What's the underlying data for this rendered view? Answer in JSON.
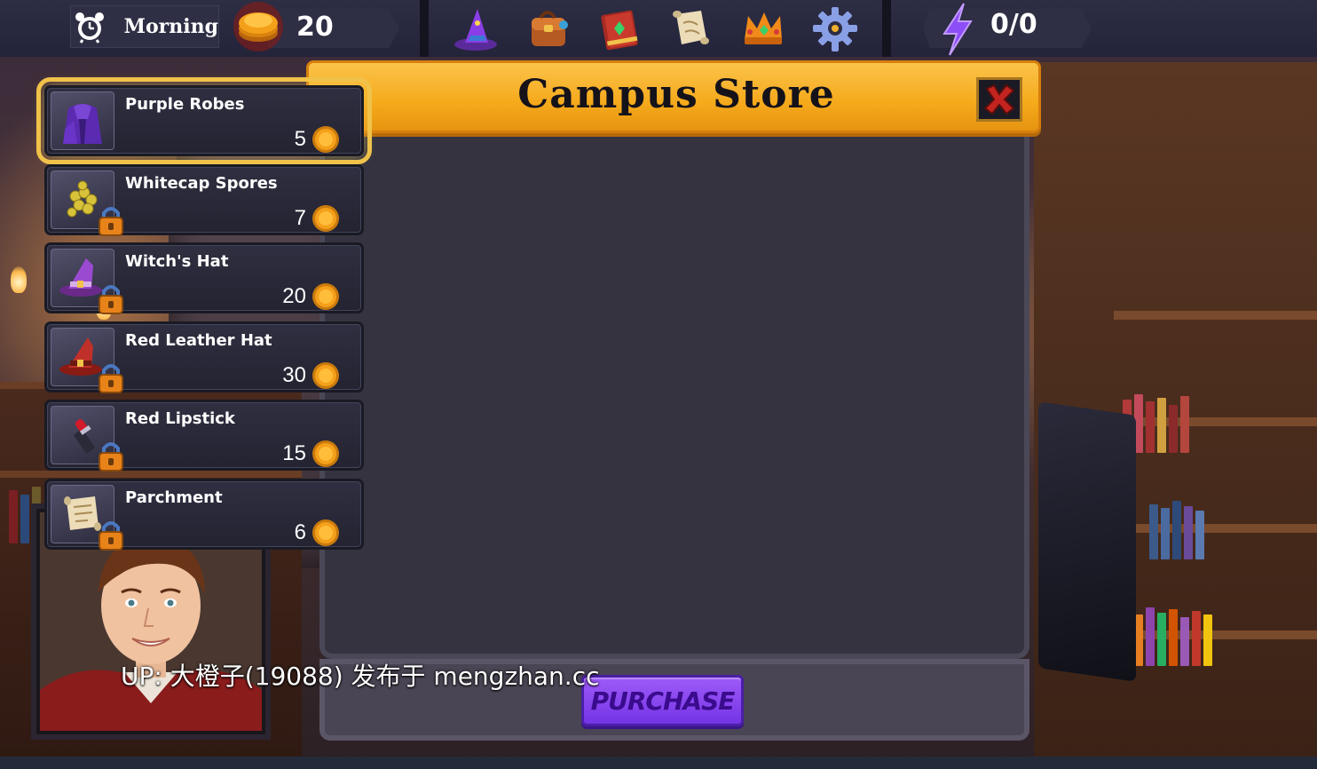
{
  "hud": {
    "time_of_day": "Morning",
    "coins": "20",
    "energy": "0/0",
    "toolbar_icons": [
      "wizard-hat-icon",
      "backpack-icon",
      "spellbook-icon",
      "scroll-map-icon",
      "crown-icon",
      "settings-gear-icon"
    ]
  },
  "store": {
    "title": "Campus Store",
    "items": [
      {
        "name": "Purple Robes",
        "price": "5",
        "locked": false,
        "selected": true,
        "icon": "purple-robes-icon"
      },
      {
        "name": "Whitecap Spores",
        "price": "7",
        "locked": true,
        "selected": false,
        "icon": "spores-icon"
      },
      {
        "name": "Witch's Hat",
        "price": "20",
        "locked": true,
        "selected": false,
        "icon": "witch-hat-icon"
      },
      {
        "name": "Red Leather Hat",
        "price": "30",
        "locked": true,
        "selected": false,
        "icon": "red-hat-icon"
      },
      {
        "name": "Red Lipstick",
        "price": "15",
        "locked": true,
        "selected": false,
        "icon": "lipstick-icon"
      },
      {
        "name": "Parchment",
        "price": "6",
        "locked": true,
        "selected": false,
        "icon": "parchment-icon"
      }
    ],
    "purchase_label": "PURCHASE"
  },
  "watermark": "UP: 大橙子(19088) 发布于 mengzhan.cc",
  "colors": {
    "title_bar": "#f5a91b",
    "purchase": "#8a47f0",
    "selected_outline": "#f0c24a",
    "coin": "#f5a01a"
  }
}
